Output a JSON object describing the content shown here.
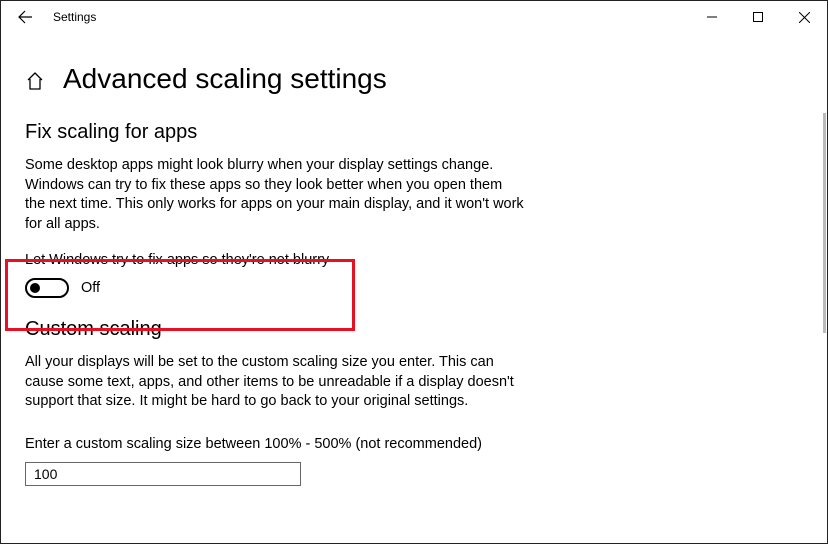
{
  "window": {
    "title": "Settings"
  },
  "header": {
    "title": "Advanced scaling settings"
  },
  "fixScaling": {
    "heading": "Fix scaling for apps",
    "description": "Some desktop apps might look blurry when your display settings change. Windows can try to fix these apps so they look better when you open them the next time. This only works for apps on your main display, and it won't work for all apps.",
    "toggleLabel": "Let Windows try to fix apps so they're not blurry",
    "toggleState": "Off"
  },
  "customScaling": {
    "heading": "Custom scaling",
    "description": "All your displays will be set to the custom scaling size you enter. This can cause some text, apps, and other items to be unreadable if a display doesn't support that size. It might be hard to go back to your original settings.",
    "fieldLabel": "Enter a custom scaling size between 100% - 500% (not recommended)",
    "fieldValue": "100"
  }
}
